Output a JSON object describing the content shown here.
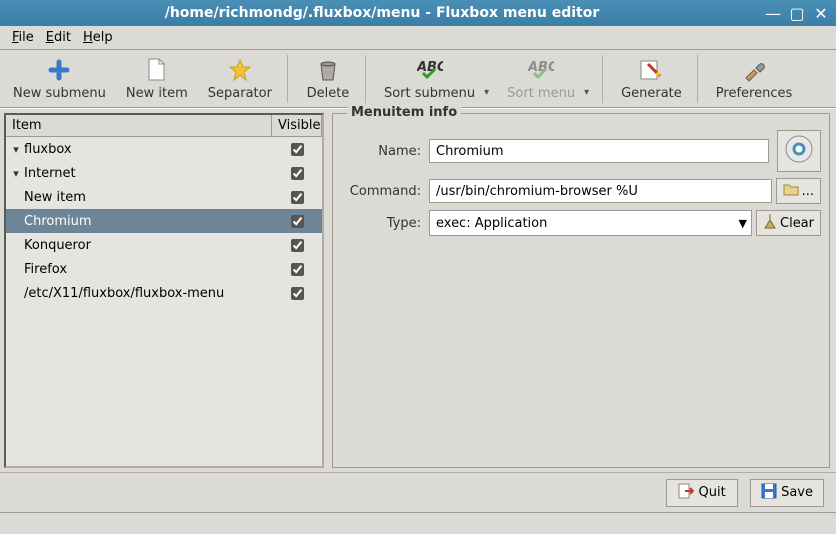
{
  "window": {
    "title": "/home/richmondg/.fluxbox/menu - Fluxbox menu editor"
  },
  "menubar": {
    "file": "File",
    "edit": "Edit",
    "help": "Help"
  },
  "toolbar": {
    "new_submenu": "New submenu",
    "new_item": "New item",
    "separator": "Separator",
    "delete": "Delete",
    "sort_submenu": "Sort submenu",
    "sort_menu": "Sort menu",
    "generate": "Generate",
    "preferences": "Preferences"
  },
  "tree": {
    "headers": {
      "item": "Item",
      "visible": "Visible"
    },
    "rows": [
      {
        "label": "fluxbox",
        "indent": 0,
        "expander": "▾",
        "checked": true,
        "selected": false
      },
      {
        "label": "Internet",
        "indent": 1,
        "expander": "▾",
        "checked": true,
        "selected": false
      },
      {
        "label": "New item",
        "indent": 2,
        "expander": "",
        "checked": true,
        "selected": false
      },
      {
        "label": "Chromium",
        "indent": 2,
        "expander": "",
        "checked": true,
        "selected": true
      },
      {
        "label": "Konqueror",
        "indent": 2,
        "expander": "",
        "checked": true,
        "selected": false
      },
      {
        "label": "Firefox",
        "indent": 2,
        "expander": "",
        "checked": true,
        "selected": false
      },
      {
        "label": "/etc/X11/fluxbox/fluxbox-menu",
        "indent": 1,
        "expander": "",
        "checked": true,
        "selected": false
      }
    ]
  },
  "info": {
    "legend": "Menuitem info",
    "name_label": "Name:",
    "name_value": "Chromium",
    "command_label": "Command:",
    "command_value": "/usr/bin/chromium-browser %U",
    "browse_btn": "...",
    "type_label": "Type:",
    "type_value": "exec: Application",
    "clear_btn": "Clear"
  },
  "bottom": {
    "quit": "Quit",
    "save": "Save"
  }
}
